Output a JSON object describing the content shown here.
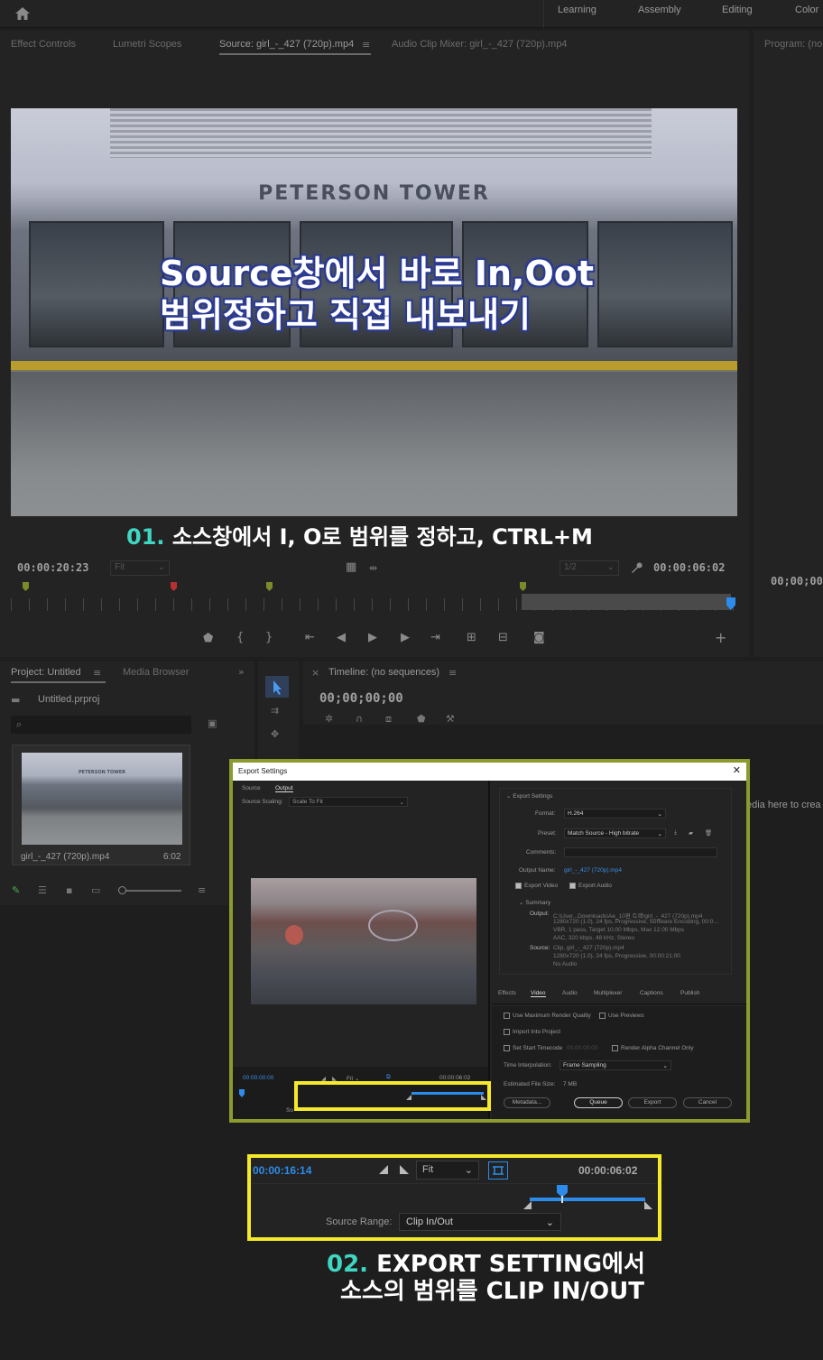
{
  "topbar": {
    "workspaces": [
      "Learning",
      "Assembly",
      "Editing",
      "Color"
    ]
  },
  "source_panel": {
    "tabs": [
      "Effect Controls",
      "Lumetri Scopes",
      "Source: girl_-_427 (720p).mp4",
      "Audio Clip Mixer: girl_-_427 (720p).mp4"
    ],
    "video_sign": "PETERSON TOWER",
    "caption_line1": "Source창에서 바로 In,Oot",
    "caption_line2": "범위정하고 직접 내보내기",
    "timecode_current": "00:00:20:23",
    "fit_label": "Fit",
    "resolution_label": "1/2",
    "timecode_duration": "00:00:06:02"
  },
  "note1": {
    "number": "01.",
    "text": "소스창에서  I, O로 범위를 정하고,  CTRL+M"
  },
  "program_panel": {
    "tab": "Program: (no",
    "timecode": "00;00;00;"
  },
  "project_panel": {
    "tabs": [
      "Project: Untitled",
      "Media Browser"
    ],
    "project_file": "Untitled.prproj",
    "clip_name": "girl_-_427 (720p).mp4",
    "clip_duration": "6:02",
    "thumb_sign": "PETERSON TOWER"
  },
  "timeline_panel": {
    "tab": "Timeline: (no sequences)",
    "timecode": "00;00;00;00",
    "drop_hint": "edia here to crea"
  },
  "export_dialog": {
    "title": "Export Settings",
    "left_tabs": [
      "Source",
      "Output"
    ],
    "source_scaling_label": "Source Scaling:",
    "source_scaling_value": "Scale To Fit",
    "section_title": "Export Settings",
    "format_label": "Format:",
    "format_value": "H.264",
    "preset_label": "Preset:",
    "preset_value": "Match Source - High bitrate",
    "comments_label": "Comments:",
    "output_name_label": "Output Name:",
    "output_name_value": "girl_-_427 (720p).mp4",
    "export_video": "Export Video",
    "export_audio": "Export Audio",
    "summary_title": "Summary",
    "output_label": "Output:",
    "output_lines": [
      "C:\\User...Downloads\\Ae_10편 트랙\\girl_-_427 (720p).mp4",
      "1280x720 (1.0), 24 fps, Progressive, Software Encoding, 00:0...",
      "VBR, 1 pass, Target 10.00 Mbps, Max 12.00 Mbps",
      "AAC, 320 kbps, 48 kHz, Stereo"
    ],
    "source_label": "Source:",
    "source_lines": [
      "Clip, girl_-_427 (720p).mp4",
      "1280x720 (1.0), 24 fps, Progressive, 00:00:21:00",
      "No Audio"
    ],
    "right_tabs": [
      "Effects",
      "Video",
      "Audio",
      "Multiplexer",
      "Captions",
      "Publish"
    ],
    "max_render": "Use Maximum Render Quality",
    "use_previews": "Use Previews",
    "import_project": "Import Into Project",
    "set_start_tc": "Set Start Timecode",
    "start_tc_value": "00:00:00:00",
    "render_alpha": "Render Alpha Channel Only",
    "time_interp_label": "Time Interpolation:",
    "time_interp_value": "Frame Sampling",
    "file_size_label": "Estimated File Size:",
    "file_size_value": "7 MB",
    "btn_metadata": "Metadata...",
    "btn_queue": "Queue",
    "btn_export": "Export",
    "btn_cancel": "Cancel",
    "tc_start": "00:00:00:00",
    "fit": "Fit",
    "tc_end": "00:00:06:02",
    "source_range_short": "So"
  },
  "zoom": {
    "timecode_current": "00:00:16:14",
    "fit_label": "Fit",
    "timecode_end": "00:00:06:02",
    "source_range_label": "Source Range:",
    "source_range_value": "Clip In/Out"
  },
  "note2": {
    "number": "02.",
    "line1": "EXPORT SETTING에서",
    "line2": "소스의 범위를 CLIP IN/OUT"
  },
  "colors": {
    "accent_blue": "#2d8ceb",
    "highlight_yellow": "#f4ea2a",
    "frame_olive": "#8c9a2e",
    "note_number": "#3fd6c2"
  }
}
